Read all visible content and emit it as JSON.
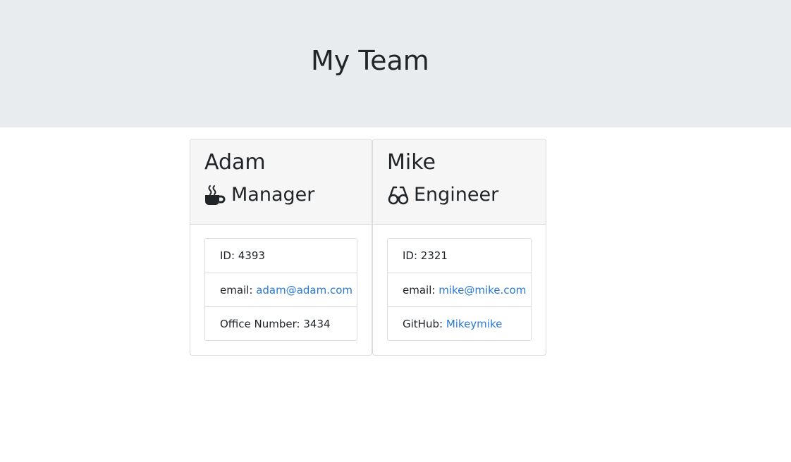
{
  "header": {
    "title": "My Team"
  },
  "cards": [
    {
      "name": "Adam",
      "role": "Manager",
      "role_icon": "coffee-mug-icon",
      "items": [
        {
          "label": "ID: ",
          "value": "4393"
        },
        {
          "label": "email: ",
          "link": "adam@adam.com"
        },
        {
          "label": "Office Number: ",
          "value": "3434"
        }
      ]
    },
    {
      "name": "Mike",
      "role": "Engineer",
      "role_icon": "glasses-icon",
      "items": [
        {
          "label": "ID: ",
          "value": "2321"
        },
        {
          "label": "email: ",
          "link": "mike@mike.com"
        },
        {
          "label": "GitHub: ",
          "link": "Mikeymike"
        }
      ]
    }
  ],
  "colors": {
    "header_bg": "#e9ecef",
    "card_header_bg": "#f6f6f6",
    "link": "#2a7ad3",
    "text": "#212529"
  }
}
